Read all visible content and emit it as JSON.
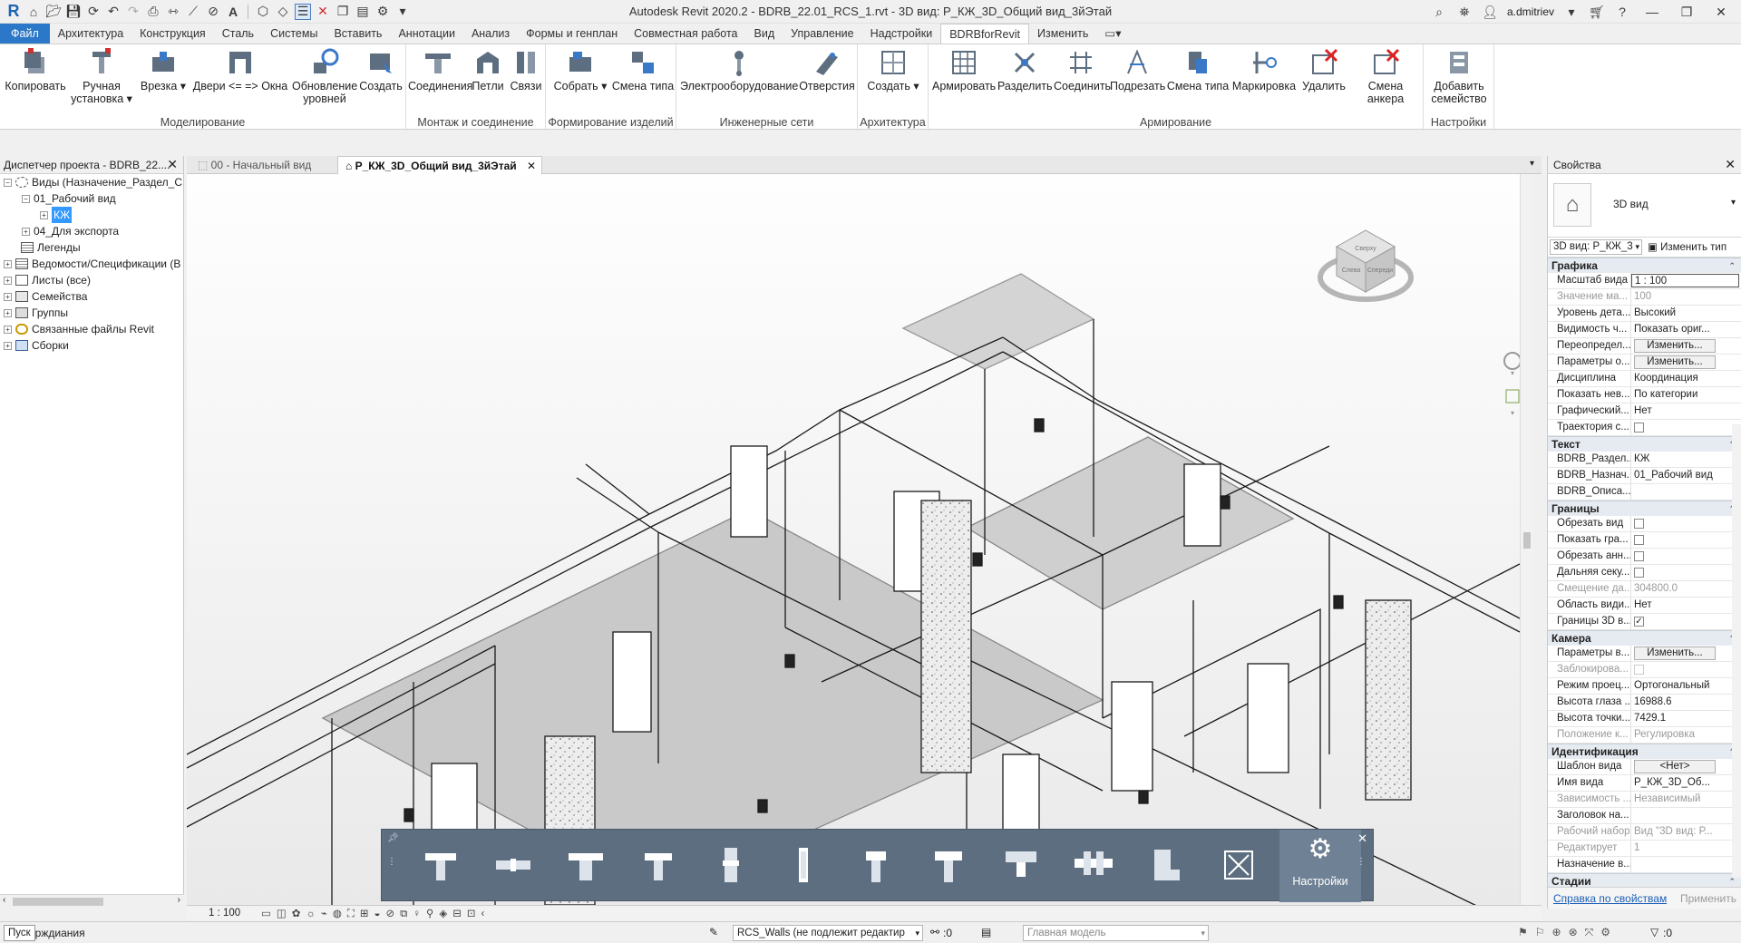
{
  "app": {
    "title": "Autodesk Revit 2020.2 - BDRB_22.01_RCS_1.rvt - 3D вид: Р_КЖ_3D_Общий вид_3йЭтай",
    "user": "a.dmitriev"
  },
  "ribbon_tabs": [
    "Файл",
    "Архитектура",
    "Конструкция",
    "Сталь",
    "Системы",
    "Вставить",
    "Аннотации",
    "Анализ",
    "Формы и генплан",
    "Совместная работа",
    "Вид",
    "Управление",
    "Надстройки",
    "BDRBforRevit",
    "Изменить"
  ],
  "ribbon": {
    "groups": [
      {
        "label": "Моделирование",
        "buttons": [
          "Копировать",
          "Ручная установка",
          "Врезка",
          "Двери <= => Окна",
          "Обновление уровней",
          "Создать"
        ]
      },
      {
        "label": "Монтаж и соединение",
        "buttons": [
          "Соединения",
          "Петли",
          "Связи"
        ]
      },
      {
        "label": "Формирование изделий",
        "buttons": [
          "Собрать",
          "Смена типа"
        ]
      },
      {
        "label": "Инженерные сети",
        "buttons": [
          "Электрооборудование",
          "Отверстия"
        ]
      },
      {
        "label": "Архитектура",
        "buttons": [
          "Создать"
        ]
      },
      {
        "label": "Армирование",
        "buttons": [
          "Армировать",
          "Разделить",
          "Соединить",
          "Подрезать",
          "Смена типа",
          "Маркировка",
          "Удалить",
          "Смена анкера"
        ]
      },
      {
        "label": "Настройки",
        "buttons": [
          "Добавить семейство"
        ]
      }
    ]
  },
  "project_browser": {
    "title": "Диспетчер проекта - BDRB_22....",
    "items": [
      {
        "label": "Виды (Назначение_Раздел_С",
        "toggle": "−"
      },
      {
        "label": "01_Рабочий вид",
        "toggle": "−"
      },
      {
        "label": "КЖ",
        "toggle": "+"
      },
      {
        "label": "04_Для экспорта",
        "toggle": "+"
      },
      {
        "label": "Легенды",
        "toggle": ""
      },
      {
        "label": "Ведомости/Спецификации (В",
        "toggle": "+"
      },
      {
        "label": "Листы (все)",
        "toggle": "+"
      },
      {
        "label": "Семейства",
        "toggle": "+"
      },
      {
        "label": "Группы",
        "toggle": "+"
      },
      {
        "label": "Связанные файлы Revit",
        "toggle": "+"
      },
      {
        "label": "Сборки",
        "toggle": "+"
      }
    ]
  },
  "view_tabs": [
    {
      "label": "00 - Начальный вид"
    },
    {
      "label": "Р_КЖ_3D_Общий вид_3йЭтай"
    }
  ],
  "viewcube": {
    "faces": [
      "Сверху",
      "Слева",
      "Спереди"
    ]
  },
  "floating_toolbar": {
    "settings_label": "Настройки"
  },
  "properties": {
    "title": "Свойства",
    "type_name": "3D вид",
    "selector": "3D вид: Р_КЖ_3",
    "edit_type": "Изменить тип",
    "sections": [
      {
        "name": "Графика",
        "rows": [
          {
            "n": "Масштаб вида",
            "v": "1 : 100",
            "kind": "input"
          },
          {
            "n": "Значение ма...",
            "v": "100",
            "kind": "dim"
          },
          {
            "n": "Уровень дета...",
            "v": "Высокий"
          },
          {
            "n": "Видимость ч...",
            "v": "Показать ориг..."
          },
          {
            "n": "Переопредел...",
            "v": "Изменить...",
            "kind": "button"
          },
          {
            "n": "Параметры о...",
            "v": "Изменить...",
            "kind": "button"
          },
          {
            "n": "Дисциплина",
            "v": "Координация"
          },
          {
            "n": "Показать нев...",
            "v": "По категории"
          },
          {
            "n": "Графический...",
            "v": "Нет"
          },
          {
            "n": "Траектория с...",
            "v": "",
            "kind": "check"
          }
        ]
      },
      {
        "name": "Текст",
        "rows": [
          {
            "n": "BDRB_Раздел...",
            "v": "КЖ"
          },
          {
            "n": "BDRB_Назнач...",
            "v": "01_Рабочий вид"
          },
          {
            "n": "BDRB_Описа...",
            "v": ""
          }
        ]
      },
      {
        "name": "Границы",
        "rows": [
          {
            "n": "Обрезать вид",
            "v": "",
            "kind": "check"
          },
          {
            "n": "Показать гра...",
            "v": "",
            "kind": "check"
          },
          {
            "n": "Обрезать анн...",
            "v": "",
            "kind": "check"
          },
          {
            "n": "Дальняя секу...",
            "v": "",
            "kind": "check"
          },
          {
            "n": "Смещение да...",
            "v": "304800.0",
            "kind": "dim"
          },
          {
            "n": "Область види...",
            "v": "Нет"
          },
          {
            "n": "Границы 3D в...",
            "v": "",
            "kind": "checked"
          }
        ]
      },
      {
        "name": "Камера",
        "rows": [
          {
            "n": "Параметры в...",
            "v": "Изменить...",
            "kind": "button"
          },
          {
            "n": "Заблокирова...",
            "v": "",
            "kind": "dimcheck"
          },
          {
            "n": "Режим проец...",
            "v": "Ортогональный"
          },
          {
            "n": "Высота глаза ...",
            "v": "16988.6"
          },
          {
            "n": "Высота точки...",
            "v": "7429.1"
          },
          {
            "n": "Положение к...",
            "v": "Регулировка",
            "kind": "dim"
          }
        ]
      },
      {
        "name": "Идентификация",
        "rows": [
          {
            "n": "Шаблон вида",
            "v": "<Нет>",
            "kind": "button"
          },
          {
            "n": "Имя вида",
            "v": "Р_КЖ_3D_Об..."
          },
          {
            "n": "Зависимость ...",
            "v": "Независимый",
            "kind": "dim"
          },
          {
            "n": "Заголовок на...",
            "v": ""
          },
          {
            "n": "Рабочий набор",
            "v": "Вид \"3D вид: Р...",
            "kind": "dim"
          },
          {
            "n": "Редактирует",
            "v": "1",
            "kind": "dim"
          },
          {
            "n": "Назначение в...",
            "v": ""
          }
        ]
      },
      {
        "name": "Стадии",
        "rows": []
      }
    ],
    "help_link": "Справка по свойствам",
    "apply": "Применить"
  },
  "view_control": {
    "scale": "1 : 100"
  },
  "status": {
    "tooltip": "Пуск",
    "message": "ерждиания",
    "workset": "RCS_Walls (не подлежит редактир",
    "count": ":0",
    "model": "Главная модель",
    "filter": ":0"
  }
}
